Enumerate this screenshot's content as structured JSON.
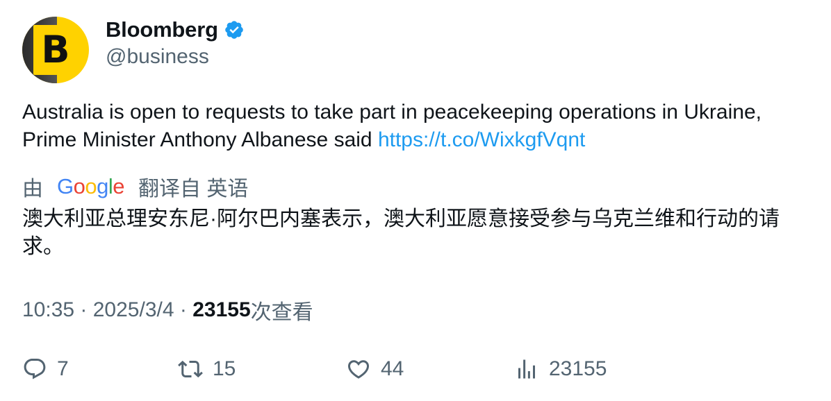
{
  "author": {
    "display_name": "Bloomberg",
    "handle": "@business",
    "avatar_letter": "B",
    "verified": true
  },
  "tweet": {
    "text": "Australia is open to requests to take part in peacekeeping operations in Ukraine, Prime Minister Anthony Albanese said ",
    "link": "https://t.co/WixkgfVqnt"
  },
  "translation": {
    "prefix": "由",
    "provider": "Google",
    "suffix": "翻译自 英语",
    "text": "澳大利亚总理安东尼·阿尔巴内塞表示，澳大利亚愿意接受参与乌克兰维和行动的请求。"
  },
  "meta": {
    "time": "10:35",
    "separator": " · ",
    "date": "2025/3/4",
    "views": "23155",
    "views_suffix": "次查看"
  },
  "actions": {
    "replies": "7",
    "retweets": "15",
    "likes": "44",
    "views": "23155"
  },
  "colors": {
    "link": "#1d9bf0",
    "secondary_text": "#536471",
    "primary_text": "#0f1419",
    "verified": "#1d9bf0",
    "avatar_bg": "#ffd200"
  }
}
